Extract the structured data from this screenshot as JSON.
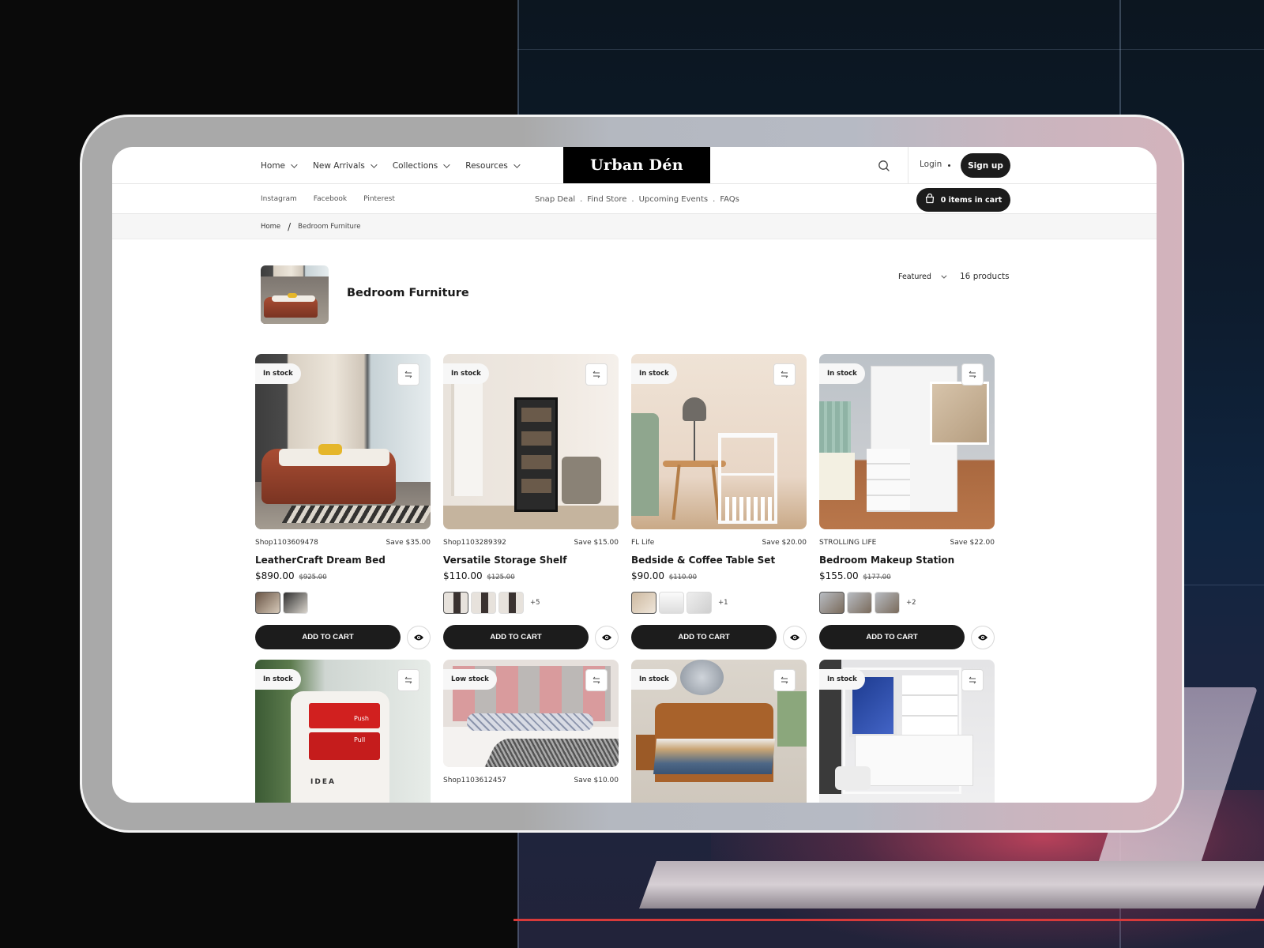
{
  "header": {
    "nav": [
      {
        "label": "Home"
      },
      {
        "label": "New Arrivals"
      },
      {
        "label": "Collections"
      },
      {
        "label": "Resources"
      }
    ],
    "logo": "Urban Dén",
    "login_label": "Login",
    "signup_label": "Sign up"
  },
  "subbar": {
    "social": [
      "Instagram",
      "Facebook",
      "Pinterest"
    ],
    "quick_links": [
      "Snap Deal",
      "Find Store",
      "Upcoming Events",
      "FAQs"
    ],
    "quick_sep": ".",
    "cart_label": "0 items in cart"
  },
  "breadcrumb": {
    "home": "Home",
    "separator": "/",
    "current": "Bedroom Furniture"
  },
  "collection": {
    "title": "Bedroom Furniture",
    "sort_label": "Featured",
    "product_count": "16 products"
  },
  "products": [
    {
      "vendor": "Shop1103609478",
      "save": "Save $35.00",
      "name": "LeatherCraft Dream Bed",
      "price": "$890.00",
      "compare_price": "$925.00",
      "stock": "In stock",
      "more_variants": "",
      "add_to_cart": "ADD TO CART"
    },
    {
      "vendor": "Shop1103289392",
      "save": "Save $15.00",
      "name": "Versatile Storage Shelf",
      "price": "$110.00",
      "compare_price": "$125.00",
      "stock": "In stock",
      "more_variants": "+5",
      "add_to_cart": "ADD TO CART"
    },
    {
      "vendor": "FL Life",
      "save": "Save $20.00",
      "name": "Bedside & Coffee Table Set",
      "price": "$90.00",
      "compare_price": "$110.00",
      "stock": "In stock",
      "more_variants": "+1",
      "add_to_cart": "ADD TO CART"
    },
    {
      "vendor": "STROLLING LIFE",
      "save": "Save $22.00",
      "name": "Bedroom Makeup Station",
      "price": "$155.00",
      "compare_price": "$177.00",
      "stock": "In stock",
      "more_variants": "+2",
      "add_to_cart": "ADD TO CART"
    },
    {
      "stock": "In stock",
      "image_text_push": "Push",
      "image_text_pull": "Pull",
      "image_text_brand": "IDEA"
    },
    {
      "vendor": "Shop1103612457",
      "save": "Save $10.00",
      "stock": "Low stock"
    },
    {
      "stock": "In stock"
    },
    {
      "stock": "In stock"
    }
  ]
}
